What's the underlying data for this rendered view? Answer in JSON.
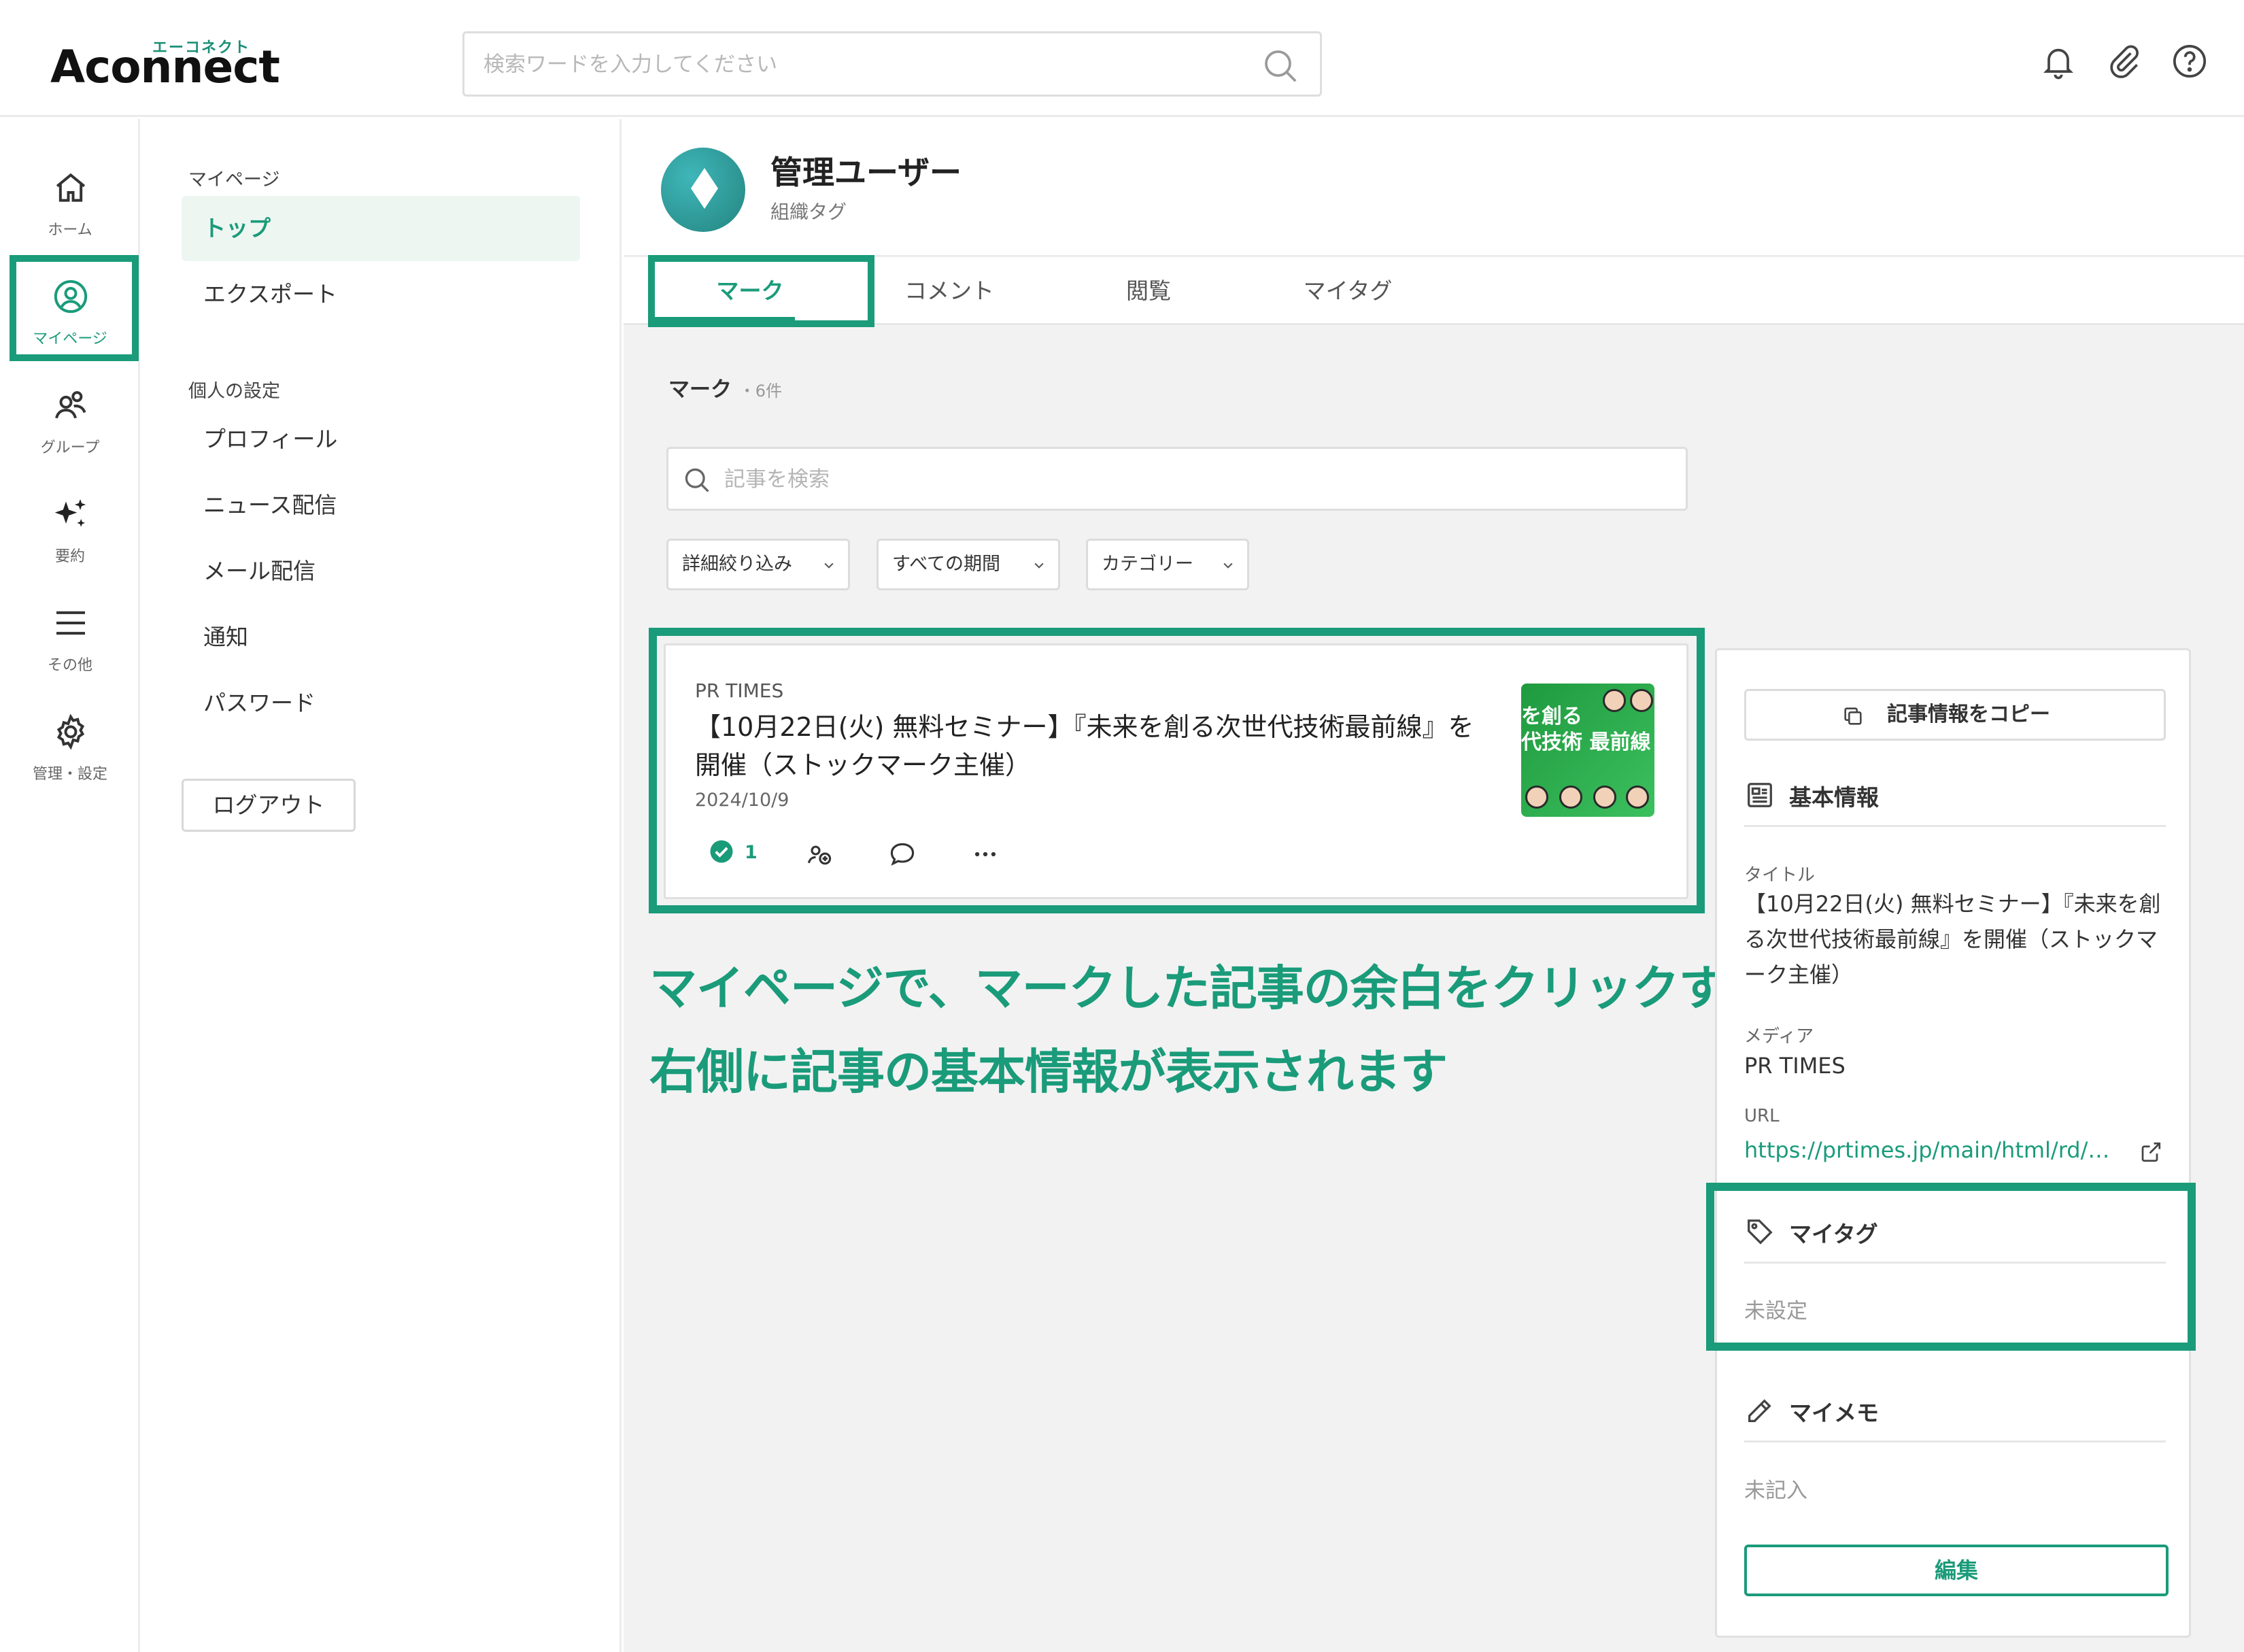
{
  "app": {
    "logo_kana": "エーコネクト",
    "logo_word": "Aconnect"
  },
  "header": {
    "search_placeholder": "検索ワードを入力してください",
    "icons": [
      "bell-icon",
      "paperclip-icon",
      "help-icon"
    ]
  },
  "rail": {
    "items": [
      {
        "label": "ホーム",
        "icon": "home-icon"
      },
      {
        "label": "マイページ",
        "icon": "user-circle-icon"
      },
      {
        "label": "グループ",
        "icon": "group-icon"
      },
      {
        "label": "要約",
        "icon": "sparkle-icon"
      },
      {
        "label": "その他",
        "icon": "menu-icon"
      },
      {
        "label": "管理・設定",
        "icon": "gear-icon"
      }
    ]
  },
  "subnav": {
    "section1": "マイページ",
    "items1": [
      "トップ",
      "エクスポート"
    ],
    "section2": "個人の設定",
    "items2": [
      "プロフィール",
      "ニュース配信",
      "メール配信",
      "通知",
      "パスワード"
    ],
    "logout": "ログアウト"
  },
  "profile": {
    "name": "管理ユーザー",
    "tag": "組織タグ"
  },
  "tabs": [
    "マーク",
    "コメント",
    "閲覧",
    "マイタグ"
  ],
  "list": {
    "heading": "マーク",
    "count": "・6件",
    "search_placeholder": "記事を検索",
    "filters": [
      "詳細絞り込み",
      "すべての期間",
      "カテゴリー"
    ]
  },
  "article": {
    "media": "PR TIMES",
    "title": "【10月22日(火) 無料セミナー】『未来を創る次世代技術最前線』を開催（ストックマーク主催）",
    "date": "2024/10/9",
    "mark_count": "1",
    "thumb_lines": [
      "を創る",
      "代技術 最前線"
    ]
  },
  "caption": {
    "line1": "マイページで、マークした記事の余白をクリックすると",
    "line2": "右側に記事の基本情報が表示されます"
  },
  "panel": {
    "copy_button": "記事情報をコピー",
    "basic_heading": "基本情報",
    "title_label": "タイトル",
    "title_value": "【10月22日(火) 無料セミナー】『未来を創る次世代技術最前線』を開催（ストックマーク主催）",
    "media_label": "メディア",
    "media_value": "PR TIMES",
    "url_label": "URL",
    "url_value": "https://prtimes.jp/main/html/rd/…",
    "mytag_heading": "マイタグ",
    "mytag_value": "未設定",
    "memo_heading": "マイメモ",
    "memo_value": "未記入",
    "edit_button": "編集"
  },
  "colors": {
    "accent": "#1a9b7a",
    "background": "#f2f2f2"
  }
}
